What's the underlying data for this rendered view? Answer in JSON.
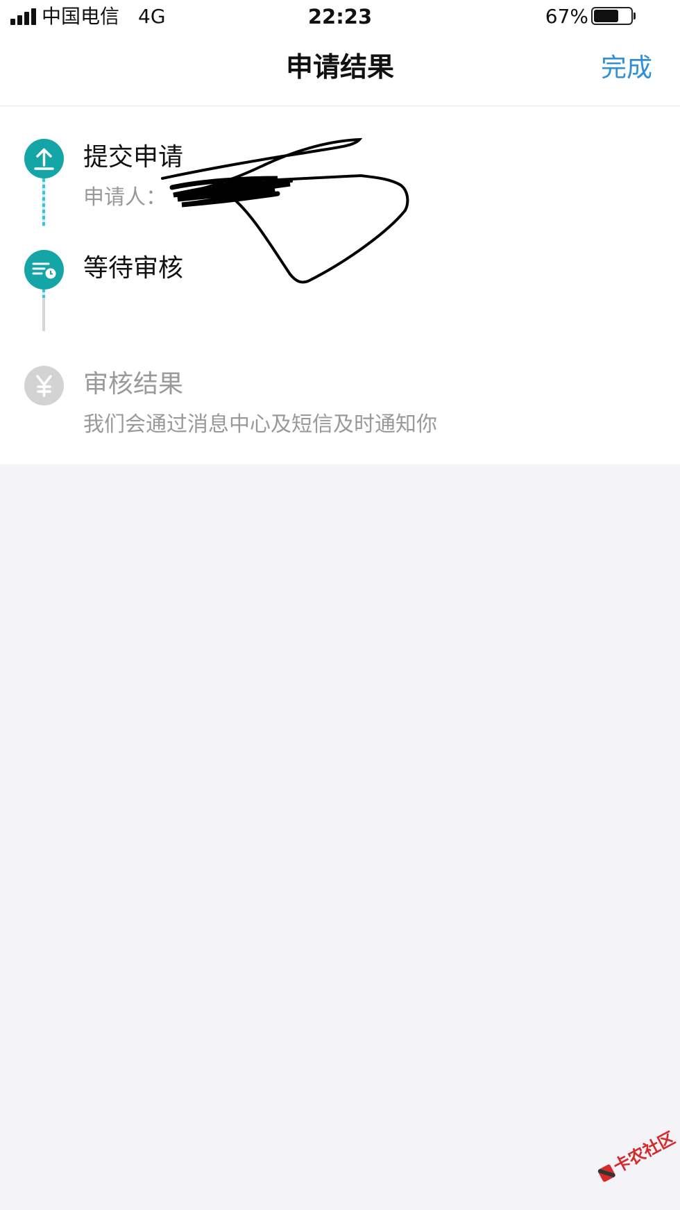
{
  "status_bar": {
    "carrier": "中国电信",
    "network": "4G",
    "time": "22:23",
    "battery_percent": "67%",
    "battery_level": 0.67
  },
  "nav": {
    "title": "申请结果",
    "done_label": "完成"
  },
  "steps": [
    {
      "title": "提交申请",
      "subtitle": "申请人：",
      "icon": "upload-icon",
      "state": "done"
    },
    {
      "title": "等待审核",
      "icon": "pending-review-icon",
      "state": "current"
    },
    {
      "title": "审核结果",
      "subtitle": "我们会通过消息中心及短信及时通知你",
      "icon": "yuan-icon",
      "state": "pending"
    }
  ],
  "colors": {
    "accent_teal": "#14a5a6",
    "line_teal": "#37c3d8",
    "link_blue": "#2f8fd8",
    "inactive_grey": "#d3d3d3",
    "page_background": "#f3f3f8"
  },
  "watermark": "卡农社区"
}
